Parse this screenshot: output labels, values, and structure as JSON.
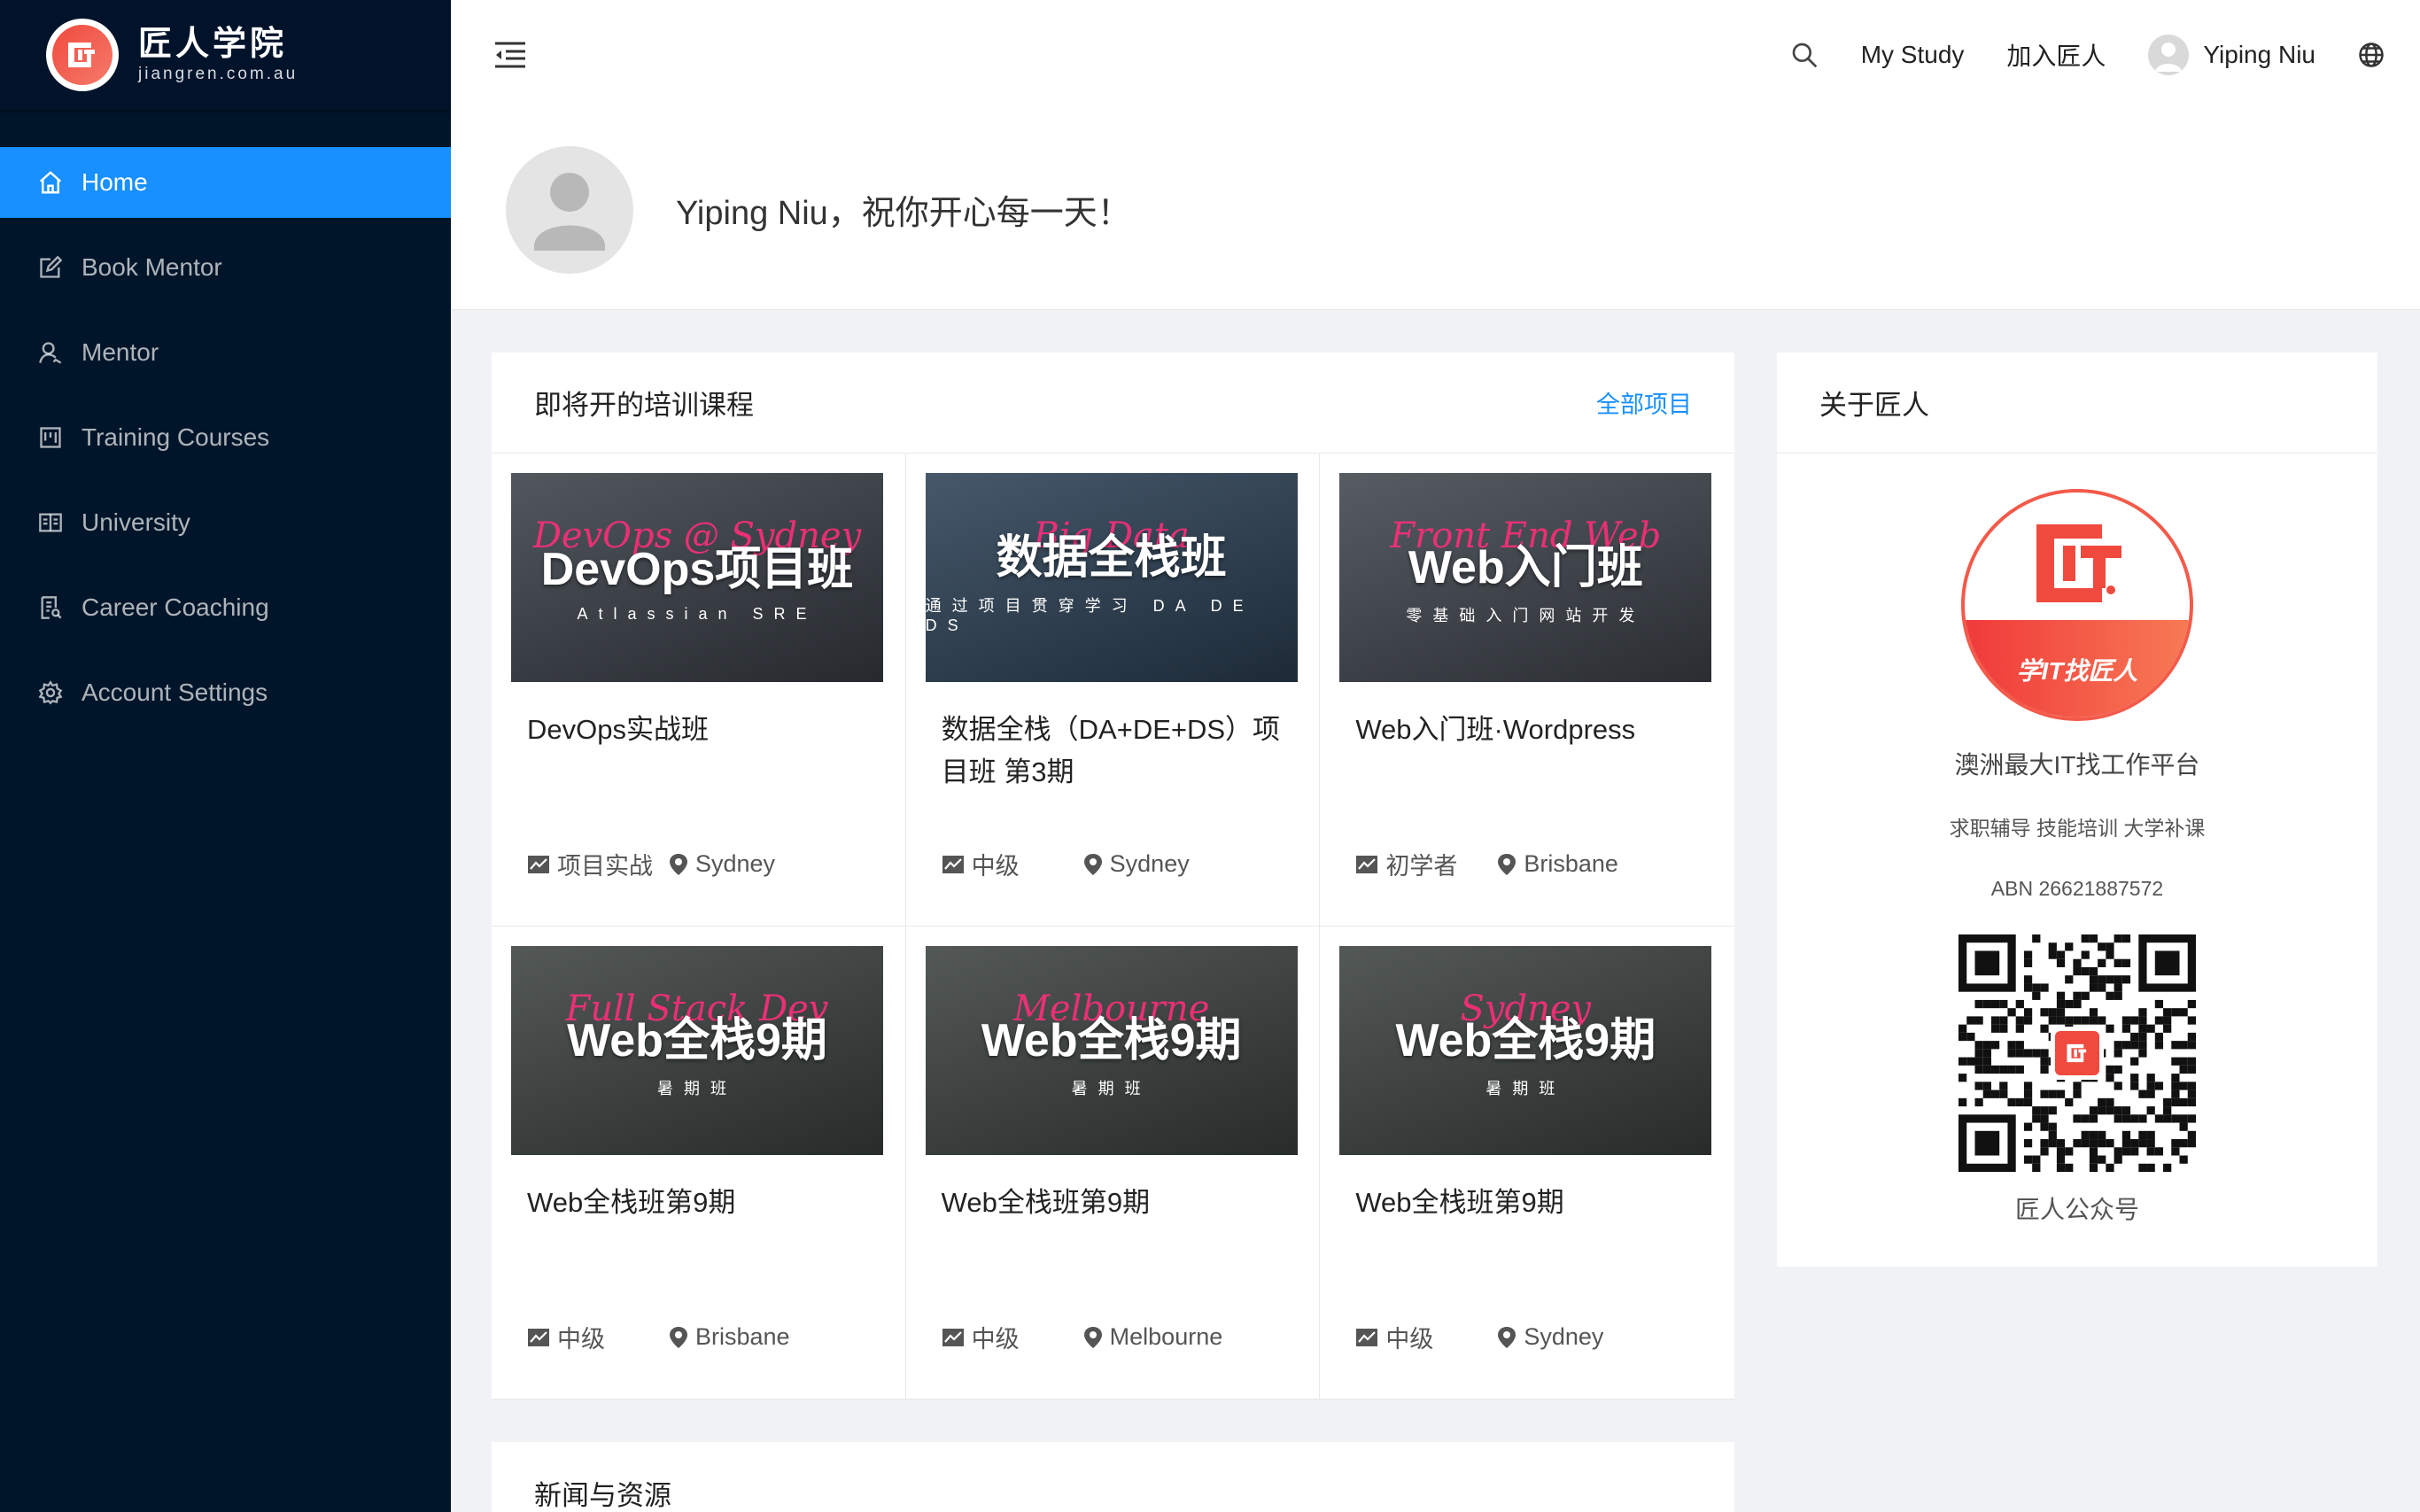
{
  "app": {
    "logo_cn": "匠人学院",
    "logo_en": "jiangren.com.au"
  },
  "sidebar": {
    "items": [
      {
        "label": "Home",
        "icon": "home-icon",
        "active": true
      },
      {
        "label": "Book Mentor",
        "icon": "edit-icon",
        "active": false
      },
      {
        "label": "Mentor",
        "icon": "user-icon",
        "active": false
      },
      {
        "label": "Training Courses",
        "icon": "project-icon",
        "active": false
      },
      {
        "label": "University",
        "icon": "book-icon",
        "active": false
      },
      {
        "label": "Career Coaching",
        "icon": "file-icon",
        "active": false
      },
      {
        "label": "Account Settings",
        "icon": "settings-icon",
        "active": false
      }
    ]
  },
  "header": {
    "my_study": "My Study",
    "join": "加入匠人",
    "user_name": "Yiping Niu"
  },
  "greeting": {
    "text": "Yiping Niu，祝你开心每一天！"
  },
  "courses": {
    "title": "即将开的培训课程",
    "more": "全部项目",
    "items": [
      {
        "title": "DevOps实战班",
        "level": "项目实战",
        "location": "Sydney",
        "img_script": "DevOps @ Sydney",
        "img_big": "DevOps项目班",
        "img_sub": "Atlassian SRE",
        "bg": "#3a4048"
      },
      {
        "title": "数据全栈（DA+DE+DS）项目班 第3期",
        "level": "中级",
        "location": "Sydney",
        "img_script": "Big Data",
        "img_big": "数据全栈班",
        "img_sub": "通过项目贯穿学习 DA DE DS",
        "bg": "#2c4156"
      },
      {
        "title": "Web入门班·Wordpress",
        "level": "初学者",
        "location": "Brisbane",
        "img_script": "Front End Web",
        "img_big": "Web入门班",
        "img_sub": "零基础入门网站开发",
        "bg": "#40464e"
      },
      {
        "title": "Web全栈班第9期",
        "level": "中级",
        "location": "Brisbane",
        "img_script": "Full Stack Dev",
        "img_big": "Web全栈9期",
        "img_sub": "暑期班",
        "bg": "#3c4240"
      },
      {
        "title": "Web全栈班第9期",
        "level": "中级",
        "location": "Melbourne",
        "img_script": "Melbourne",
        "img_big": "Web全栈9期",
        "img_sub": "暑期班",
        "bg": "#3c4240"
      },
      {
        "title": "Web全栈班第9期",
        "level": "中级",
        "location": "Sydney",
        "img_script": "Sydney",
        "img_big": "Web全栈9期",
        "img_sub": "暑期班",
        "bg": "#3c4240"
      }
    ]
  },
  "news": {
    "title": "新闻与资源"
  },
  "about": {
    "title": "关于匠人",
    "logo_slogan": "学IT找匠人",
    "tagline": "澳洲最大IT找工作平台",
    "services": "求职辅导 技能培训 大学补课",
    "abn": "ABN 26621887572",
    "qr_caption": "匠人公众号"
  },
  "colors": {
    "sidebar_bg": "#001529",
    "accent": "#1890ff",
    "brand": "#f04a3e"
  }
}
